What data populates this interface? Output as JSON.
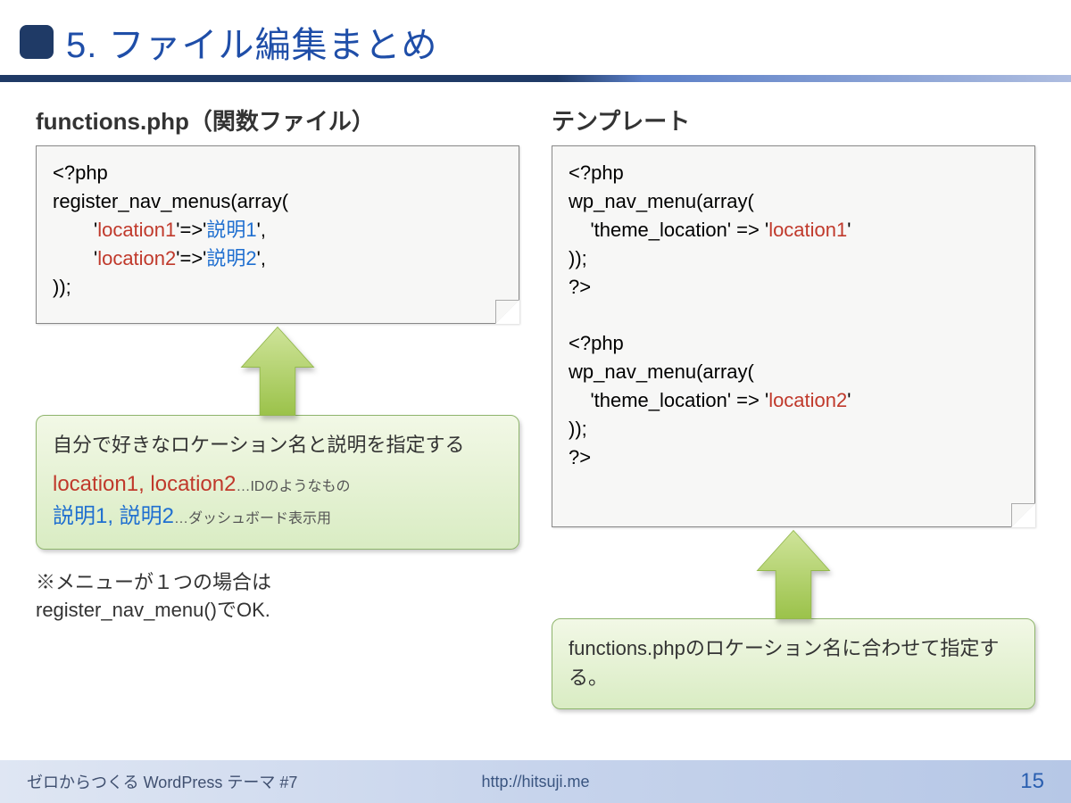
{
  "title": "5. ファイル編集まとめ",
  "left": {
    "heading": "functions.php（関数ファイル）",
    "code": {
      "l1": "<?php",
      "l2": "register_nav_menus(array(",
      "l3a": "'",
      "l3b": "location1",
      "l3c": "'=>'",
      "l3d": "説明1",
      "l3e": "',",
      "l4a": "'",
      "l4b": "location2",
      "l4c": "'=>'",
      "l4d": "説明2",
      "l4e": "',",
      "l5": "));"
    },
    "callout": {
      "main": "自分で好きなロケーション名と説明を指定する",
      "sub1_red": "location1, location2",
      "sub1_small": "…IDのようなもの",
      "sub2_blue": "説明1, 説明2",
      "sub2_small": "…ダッシュボード表示用"
    },
    "note": "※メニューが１つの場合は\nregister_nav_menu()でOK."
  },
  "right": {
    "heading": "テンプレート",
    "code": {
      "l1": "<?php",
      "l2": "wp_nav_menu(array(",
      "l3a": "    'theme_location' => '",
      "l3b": "location1",
      "l3c": "'",
      "l4": "));",
      "l5": "?>",
      "gap": "",
      "l6": "<?php",
      "l7": "wp_nav_menu(array(",
      "l8a": "    'theme_location' => '",
      "l8b": "location2",
      "l8c": "'",
      "l9": "));",
      "l10": "?>"
    },
    "callout": "functions.phpのロケーション名に合わせて指定する。"
  },
  "footer": {
    "left": "ゼロからつくる WordPress テーマ #7",
    "center": "http://hitsuji.me",
    "page": "15"
  }
}
